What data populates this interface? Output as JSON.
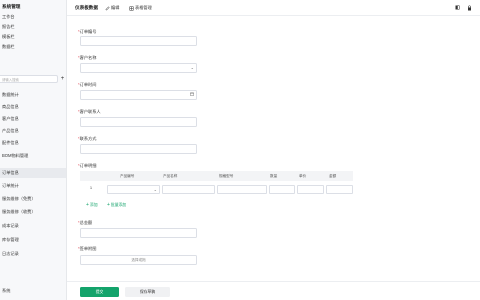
{
  "sidebar": {
    "title": "系统管理",
    "search_placeholder": "请输入搜索",
    "items": [
      {
        "label": "工作台",
        "active": false
      },
      {
        "label": "报告栏",
        "active": false
      },
      {
        "label": "模板栏",
        "active": false
      },
      {
        "label": "数据栏",
        "active": false
      },
      {
        "label": "数据统计",
        "active": false
      },
      {
        "label": "商品信息",
        "active": false
      },
      {
        "label": "客户信息",
        "active": false
      },
      {
        "label": "产品信息",
        "active": false
      },
      {
        "label": "配件信息",
        "active": false
      },
      {
        "label": "BOM物料管理",
        "active": false
      },
      {
        "label": "订单信息",
        "active": true
      },
      {
        "label": "订单统计",
        "active": false
      },
      {
        "label": "服务维修（免费）",
        "active": false
      },
      {
        "label": "服务维修（收费）",
        "active": false
      },
      {
        "label": "成本记录",
        "active": false
      },
      {
        "label": "库存管理",
        "active": false
      },
      {
        "label": "日志记录",
        "active": false
      }
    ],
    "footer": "系统"
  },
  "topbar": {
    "title": "仪表板数据",
    "edit_label": "编辑",
    "manage_label": "表格管理"
  },
  "form": {
    "order_no": {
      "label": "订单编号",
      "value": ""
    },
    "customer": {
      "label": "客户名称",
      "value": ""
    },
    "order_time": {
      "label": "订单时间",
      "value": ""
    },
    "contact": {
      "label": "客户联系人",
      "value": ""
    },
    "phone": {
      "label": "联系方式",
      "value": ""
    },
    "details": {
      "label": "订单明细"
    },
    "amount": {
      "label": "总金额",
      "value": ""
    },
    "attachment": {
      "label": "签单附图",
      "upload_text": "选择或拖"
    }
  },
  "table": {
    "columns": [
      "产品编号",
      "产品名称",
      "规格型号",
      "数量",
      "单价",
      "金额"
    ],
    "rows": [
      {
        "index": "1"
      }
    ],
    "add_label": "添加",
    "batch_label": "批量添加"
  },
  "buttons": {
    "submit": "提交",
    "save_draft": "保存草稿"
  },
  "colors": {
    "accent": "#13a36b",
    "required": "#e34d59"
  }
}
